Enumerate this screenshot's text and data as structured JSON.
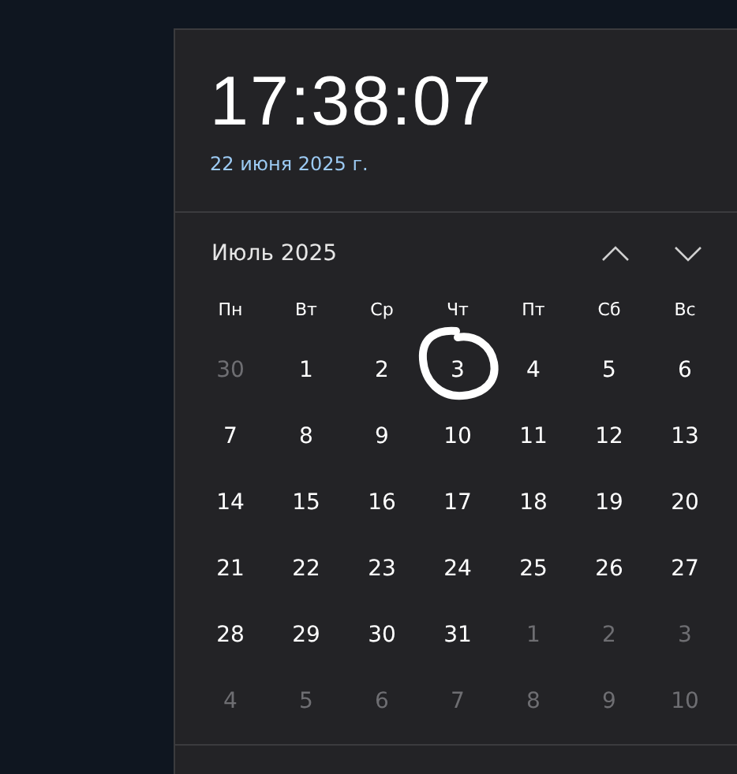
{
  "clock": {
    "time": "17:38:07",
    "date": "22 июня 2025 г."
  },
  "calendar": {
    "month": "Июль 2025",
    "weekdays": [
      "Пн",
      "Вт",
      "Ср",
      "Чт",
      "Пт",
      "Сб",
      "Вс"
    ],
    "days": [
      {
        "label": "30",
        "in_month": false,
        "circled": false
      },
      {
        "label": "1",
        "in_month": true,
        "circled": false
      },
      {
        "label": "2",
        "in_month": true,
        "circled": false
      },
      {
        "label": "3",
        "in_month": true,
        "circled": true
      },
      {
        "label": "4",
        "in_month": true,
        "circled": false
      },
      {
        "label": "5",
        "in_month": true,
        "circled": false
      },
      {
        "label": "6",
        "in_month": true,
        "circled": false
      },
      {
        "label": "7",
        "in_month": true,
        "circled": false
      },
      {
        "label": "8",
        "in_month": true,
        "circled": false
      },
      {
        "label": "9",
        "in_month": true,
        "circled": false
      },
      {
        "label": "10",
        "in_month": true,
        "circled": false
      },
      {
        "label": "11",
        "in_month": true,
        "circled": false
      },
      {
        "label": "12",
        "in_month": true,
        "circled": false
      },
      {
        "label": "13",
        "in_month": true,
        "circled": false
      },
      {
        "label": "14",
        "in_month": true,
        "circled": false
      },
      {
        "label": "15",
        "in_month": true,
        "circled": false
      },
      {
        "label": "16",
        "in_month": true,
        "circled": false
      },
      {
        "label": "17",
        "in_month": true,
        "circled": false
      },
      {
        "label": "18",
        "in_month": true,
        "circled": false
      },
      {
        "label": "19",
        "in_month": true,
        "circled": false
      },
      {
        "label": "20",
        "in_month": true,
        "circled": false
      },
      {
        "label": "21",
        "in_month": true,
        "circled": false
      },
      {
        "label": "22",
        "in_month": true,
        "circled": false
      },
      {
        "label": "23",
        "in_month": true,
        "circled": false
      },
      {
        "label": "24",
        "in_month": true,
        "circled": false
      },
      {
        "label": "25",
        "in_month": true,
        "circled": false
      },
      {
        "label": "26",
        "in_month": true,
        "circled": false
      },
      {
        "label": "27",
        "in_month": true,
        "circled": false
      },
      {
        "label": "28",
        "in_month": true,
        "circled": false
      },
      {
        "label": "29",
        "in_month": true,
        "circled": false
      },
      {
        "label": "30",
        "in_month": true,
        "circled": false
      },
      {
        "label": "31",
        "in_month": true,
        "circled": false
      },
      {
        "label": "1",
        "in_month": false,
        "circled": false
      },
      {
        "label": "2",
        "in_month": false,
        "circled": false
      },
      {
        "label": "3",
        "in_month": false,
        "circled": false
      },
      {
        "label": "4",
        "in_month": false,
        "circled": false
      },
      {
        "label": "5",
        "in_month": false,
        "circled": false
      },
      {
        "label": "6",
        "in_month": false,
        "circled": false
      },
      {
        "label": "7",
        "in_month": false,
        "circled": false
      },
      {
        "label": "8",
        "in_month": false,
        "circled": false
      },
      {
        "label": "9",
        "in_month": false,
        "circled": false
      },
      {
        "label": "10",
        "in_month": false,
        "circled": false
      }
    ]
  }
}
